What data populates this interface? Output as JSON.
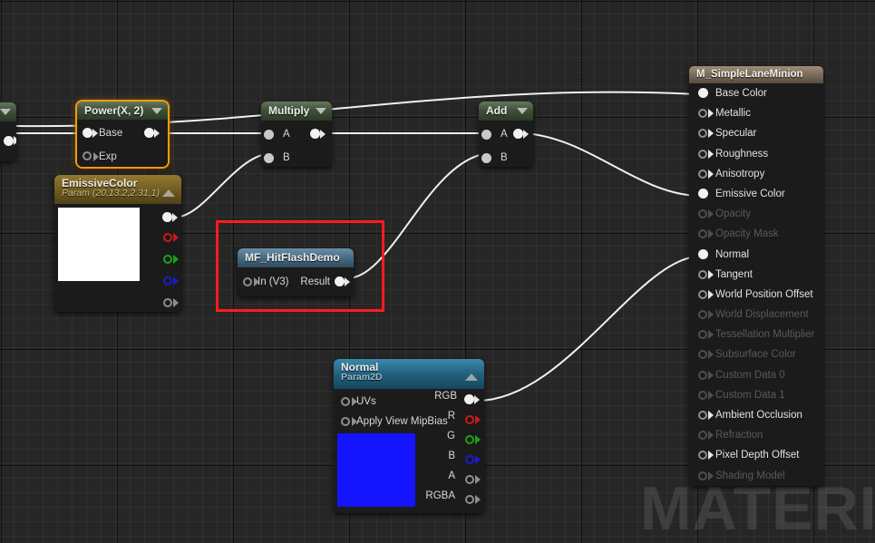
{
  "app": {
    "watermark": "MATERIA"
  },
  "nodes": {
    "power": {
      "title": "Power(X, 2)",
      "inputs": [
        "Base",
        "Exp"
      ]
    },
    "emissive": {
      "title": "EmissiveColor",
      "subtitle": "Param (20,13.2,2.31,1)",
      "swatch_color": "#ffffff",
      "outputs": [
        "",
        "R",
        "G",
        "B",
        "A"
      ]
    },
    "multiply": {
      "title": "Multiply",
      "inputs": [
        "A",
        "B"
      ]
    },
    "add": {
      "title": "Add",
      "inputs": [
        "A",
        "B"
      ]
    },
    "hitflash": {
      "title": "MF_HitFlashDemo",
      "input": "In (V3)",
      "output": "Result"
    },
    "normal": {
      "title": "Normal",
      "subtitle": "Param2D",
      "swatch_color": "#1414ff",
      "inputs": [
        "UVs",
        "Apply View MipBias"
      ],
      "outputs": [
        "RGB",
        "R",
        "G",
        "B",
        "A",
        "RGBA"
      ]
    },
    "material": {
      "title": "M_SimpleLaneMinion",
      "pins": [
        {
          "label": "Base Color",
          "connected": true,
          "enabled": true
        },
        {
          "label": "Metallic",
          "connected": false,
          "enabled": true
        },
        {
          "label": "Specular",
          "connected": false,
          "enabled": true
        },
        {
          "label": "Roughness",
          "connected": false,
          "enabled": true
        },
        {
          "label": "Anisotropy",
          "connected": false,
          "enabled": true
        },
        {
          "label": "Emissive Color",
          "connected": true,
          "enabled": true
        },
        {
          "label": "Opacity",
          "connected": false,
          "enabled": false
        },
        {
          "label": "Opacity Mask",
          "connected": false,
          "enabled": false
        },
        {
          "label": "Normal",
          "connected": true,
          "enabled": true
        },
        {
          "label": "Tangent",
          "connected": false,
          "enabled": true
        },
        {
          "label": "World Position Offset",
          "connected": false,
          "enabled": true
        },
        {
          "label": "World Displacement",
          "connected": false,
          "enabled": false
        },
        {
          "label": "Tessellation Multiplier",
          "connected": false,
          "enabled": false
        },
        {
          "label": "Subsurface Color",
          "connected": false,
          "enabled": false
        },
        {
          "label": "Custom Data 0",
          "connected": false,
          "enabled": false
        },
        {
          "label": "Custom Data 1",
          "connected": false,
          "enabled": false
        },
        {
          "label": "Ambient Occlusion",
          "connected": false,
          "enabled": true
        },
        {
          "label": "Refraction",
          "connected": false,
          "enabled": false
        },
        {
          "label": "Pixel Depth Offset",
          "connected": false,
          "enabled": true
        },
        {
          "label": "Shading Model",
          "connected": false,
          "enabled": false
        }
      ]
    }
  },
  "colors": {
    "selection_outline": "#ff1c1c",
    "node_selected_outline": "#f49a12",
    "wire": "#f0f0f0",
    "canvas_background": "#262626"
  }
}
